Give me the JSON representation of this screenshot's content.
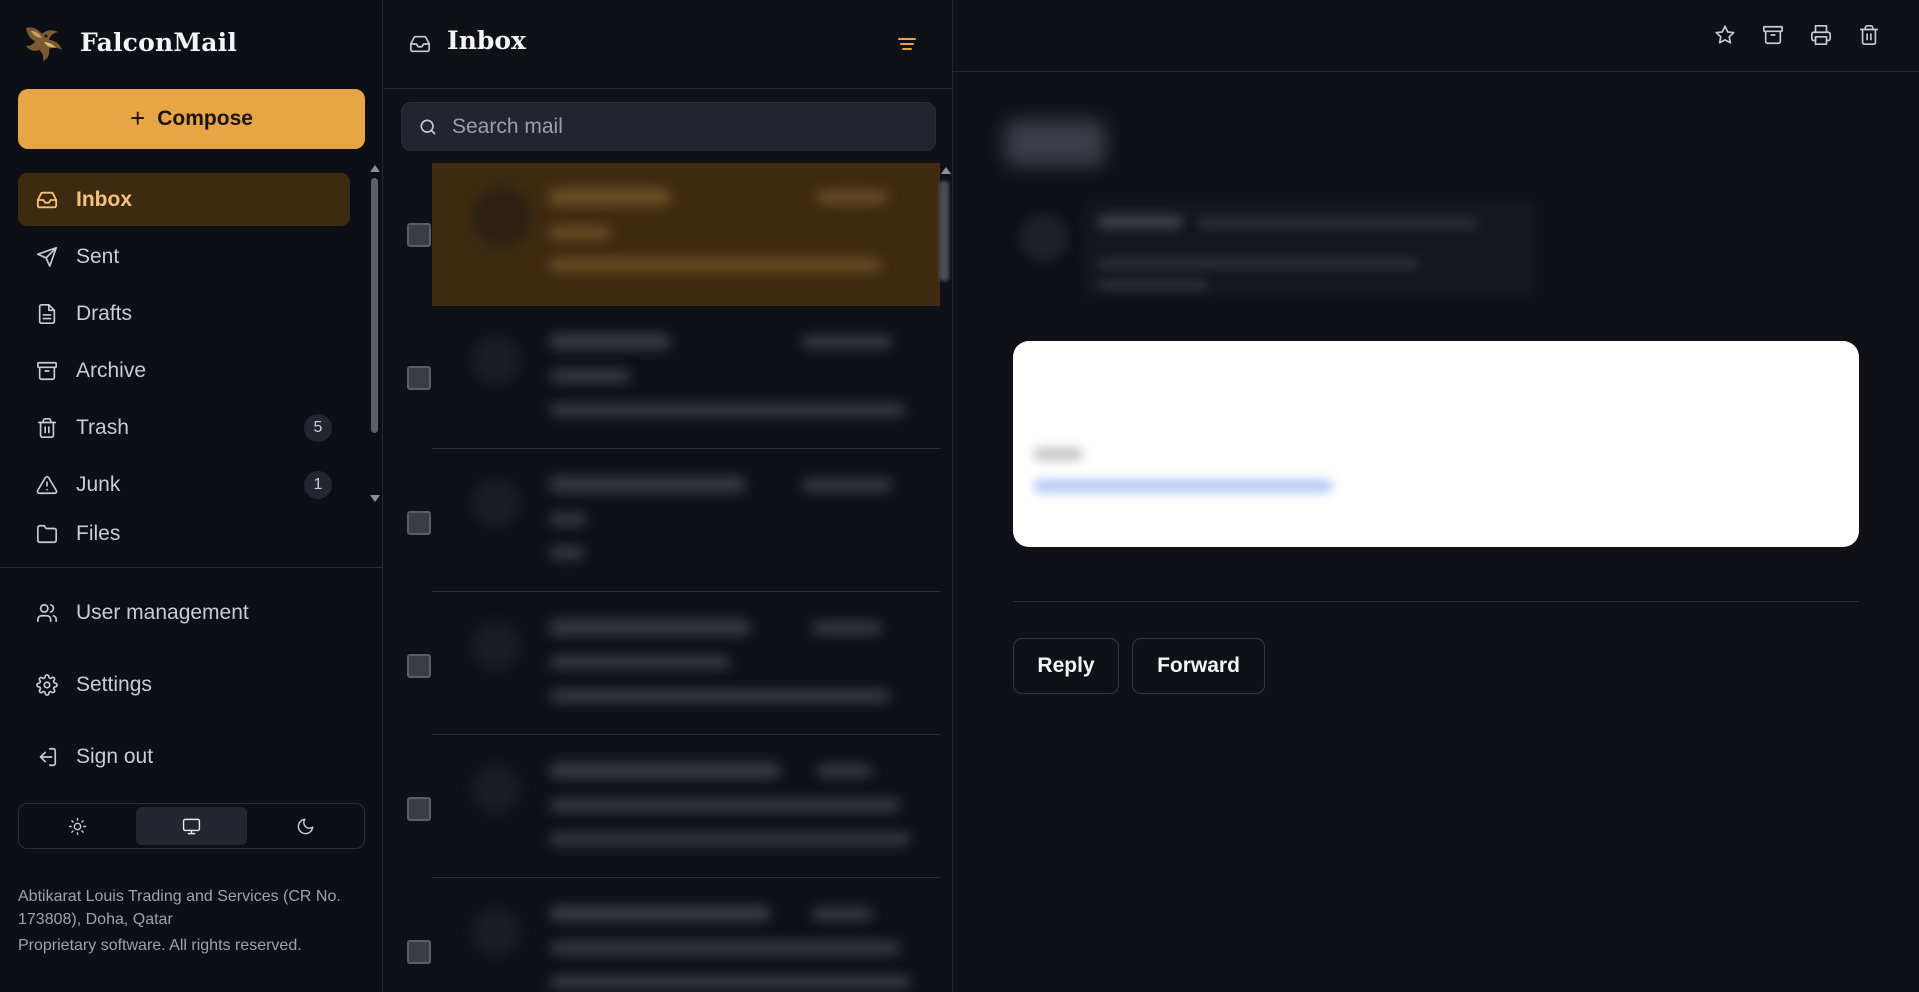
{
  "app": {
    "name": "FalconMail"
  },
  "sidebar": {
    "compose_label": "Compose",
    "items": [
      {
        "label": "Inbox",
        "icon": "inbox-icon",
        "active": true
      },
      {
        "label": "Sent",
        "icon": "send-icon"
      },
      {
        "label": "Drafts",
        "icon": "drafts-icon"
      },
      {
        "label": "Archive",
        "icon": "archive-icon"
      },
      {
        "label": "Trash",
        "icon": "trash-icon",
        "count": "5"
      },
      {
        "label": "Junk",
        "icon": "warning-icon",
        "count": "1"
      },
      {
        "label": "Files",
        "icon": "folder-icon"
      }
    ],
    "bottom_items": [
      {
        "label": "User management",
        "icon": "users-icon"
      },
      {
        "label": "Settings",
        "icon": "gear-icon"
      },
      {
        "label": "Sign out",
        "icon": "sign-out-icon"
      }
    ],
    "theme": {
      "options": [
        "light",
        "system",
        "dark"
      ],
      "selected": "system"
    },
    "footer": {
      "company": "Abtikarat Louis Trading and Services (CR No. 173808), Doha, Qatar",
      "license": "Proprietary software. All rights reserved."
    }
  },
  "list": {
    "title": "Inbox",
    "search_placeholder": "Search mail",
    "selected_index": 0
  },
  "reader": {
    "actions": {
      "reply": "Reply",
      "forward": "Forward"
    },
    "toolbar_icons": [
      "star-icon",
      "archive-icon",
      "print-icon",
      "trash-icon"
    ]
  },
  "colors": {
    "accent": "#e7a544",
    "active_nav_bg": "#3e2a10",
    "active_nav_text": "#f3c37a",
    "background": "#0f1117",
    "sidebar_bg": "#0c0f16"
  }
}
